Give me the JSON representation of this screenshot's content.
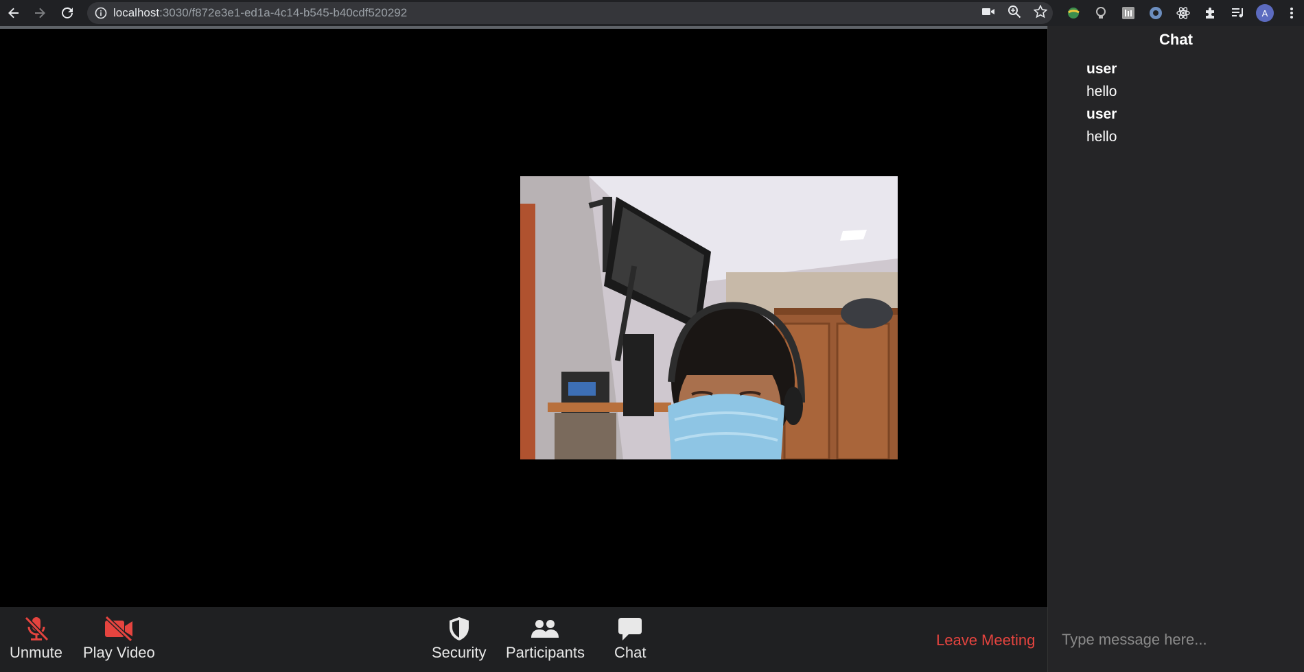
{
  "browser": {
    "url_host": "localhost",
    "url_path": ":3030/f872e3e1-ed1a-4c14-b545-b40cdf520292",
    "avatar_letter": "A"
  },
  "toolbar": {
    "unmute_label": "Unmute",
    "play_video_label": "Play Video",
    "security_label": "Security",
    "participants_label": "Participants",
    "chat_label": "Chat",
    "leave_label": "Leave Meeting"
  },
  "chat": {
    "title": "Chat",
    "messages": [
      {
        "user": "user",
        "text": "hello"
      },
      {
        "user": "user",
        "text": "hello"
      }
    ],
    "input_placeholder": "Type message here..."
  },
  "colors": {
    "accent_red": "#e5443f",
    "toolbar_bg": "#1f2022",
    "panel_bg": "#252527"
  }
}
